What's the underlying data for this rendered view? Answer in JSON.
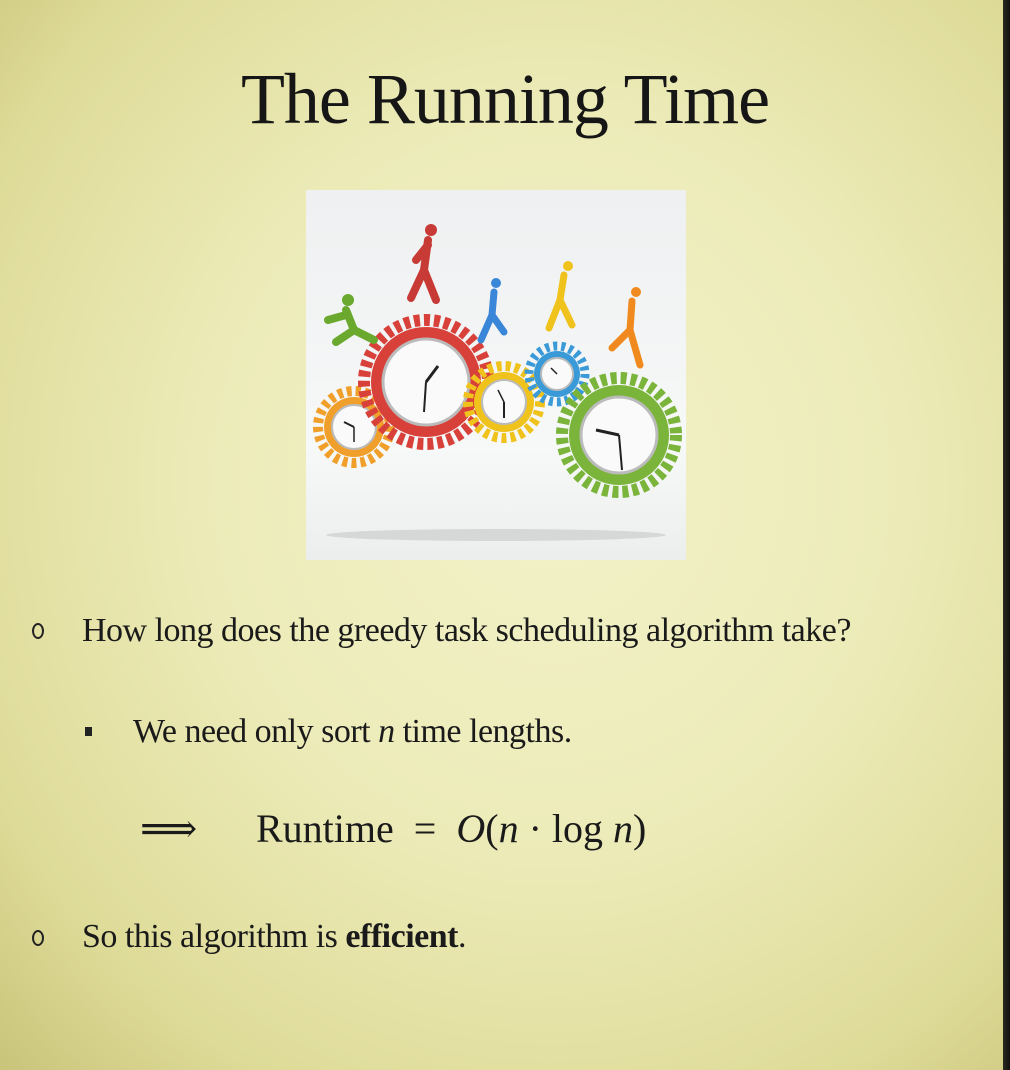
{
  "slide": {
    "title": "The Running Time",
    "illustration": {
      "alt": "runners-on-clock-gears-illustration",
      "colors": [
        "#d8413a",
        "#7ab43a",
        "#3a86d8",
        "#f0c21c",
        "#f08a1e"
      ]
    },
    "bullets": [
      {
        "text": "How long does the greedy task scheduling algorithm take?",
        "sub": {
          "prefix": "We need only sort ",
          "var": "n",
          "suffix": " time lengths."
        }
      },
      {
        "prefix": "So this algorithm is ",
        "bold": "efficient",
        "suffix": "."
      }
    ],
    "formula": {
      "implies": "⟹",
      "lhs": "Runtime",
      "eq": "=",
      "rhs_big_o": "O",
      "rhs_open": "(",
      "rhs_n1": "n",
      "rhs_dot": " · log ",
      "rhs_n2": "n",
      "rhs_close": ")"
    }
  }
}
